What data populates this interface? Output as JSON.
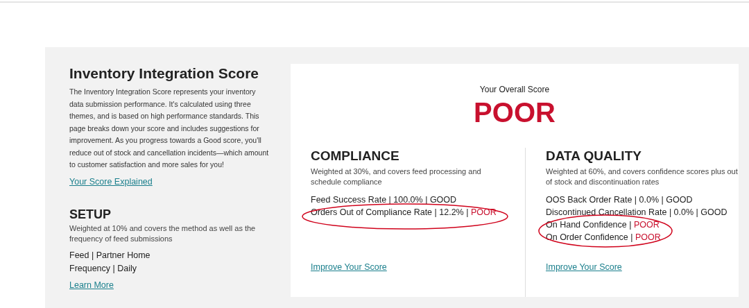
{
  "intro": {
    "title": "Inventory Integration Score",
    "description": "The Inventory Integration Score represents your inventory data submission performance. It's calculated using three themes, and is based on high performance standards. This page breaks down your score and includes suggestions for improvement. As you progress towards a Good score, you'll reduce out of stock and cancellation incidents—which amount to customer satisfaction and more sales for you!",
    "link": "Your Score Explained"
  },
  "setup": {
    "title": "SETUP",
    "description": "Weighted at 10% and covers the method as well as the frequency of feed submissions",
    "items": [
      {
        "text": "Feed | Partner Home"
      },
      {
        "text": "Frequency | Daily"
      }
    ],
    "link": "Learn More"
  },
  "overall": {
    "label": "Your Overall Score",
    "rating": "POOR",
    "color": "#c8102e"
  },
  "sections": [
    {
      "title": "COMPLIANCE",
      "description": "Weighted at 30%, and covers feed processing and schedule compliance",
      "metrics": [
        {
          "label": "Feed Success Rate | 100.0% |",
          "rating": "GOOD",
          "color": "#222222",
          "circled": false
        },
        {
          "label": "Orders Out of Compliance Rate | 12.2% |",
          "rating": "POOR",
          "color": "#c8102e",
          "circled": true
        }
      ],
      "link": "Improve Your Score"
    },
    {
      "title": "DATA QUALITY",
      "description": "Weighted at 60%, and covers confidence scores plus out of stock and discontinuation rates",
      "metrics": [
        {
          "label": "OOS Back Order Rate | 0.0% |",
          "rating": "GOOD",
          "color": "#222222",
          "circled": false
        },
        {
          "label": "Discontinued Cancellation Rate | 0.0% |",
          "rating": "GOOD",
          "color": "#222222",
          "circled": false
        },
        {
          "label": "On Hand Confidence |",
          "rating": "POOR",
          "color": "#c8102e",
          "circled": true
        },
        {
          "label": "On Order Confidence |",
          "rating": "POOR",
          "color": "#c8102e",
          "circled": true
        }
      ],
      "link": "Improve Your Score"
    }
  ]
}
